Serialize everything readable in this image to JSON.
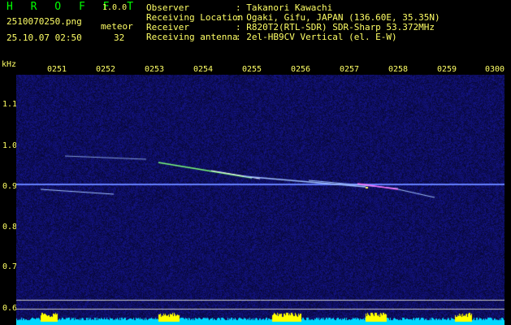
{
  "app": {
    "title": "H R O F F T",
    "version": "1.0.0"
  },
  "file": {
    "name": "2510070250.png",
    "datetime": "25.10.07 02:50"
  },
  "event": {
    "type": "meteor",
    "count": "32"
  },
  "info": [
    {
      "key": "Observer",
      "value": ": Takanori Kawachi"
    },
    {
      "key": "Receiving Location",
      "value": ": Ogaki, Gifu, JAPAN (136.60E, 35.35N)"
    },
    {
      "key": "Receiver",
      "value": ": R820T2(RTL-SDR) SDR-Sharp 53.372MHz"
    },
    {
      "key": "Receiving antenna",
      "value": ": 2el-HB9CV Vertical (el. E-W)"
    }
  ],
  "axis": {
    "y_unit": "kHz",
    "x_ticks": [
      "0251",
      "0252",
      "0253",
      "0254",
      "0255",
      "0256",
      "0257",
      "0258",
      "0259",
      "0300"
    ],
    "y_ticks": [
      "1.1",
      "1.0",
      "0.9",
      "0.8",
      "0.7",
      "0.6"
    ]
  },
  "colors": {
    "background": "#000000",
    "text": "#ffff66",
    "title": "#00ff00",
    "noise": "#1a1a6e",
    "carrier": "#4060ff",
    "level_fill": "#00d8ff",
    "level_peak": "#ffff00"
  }
}
